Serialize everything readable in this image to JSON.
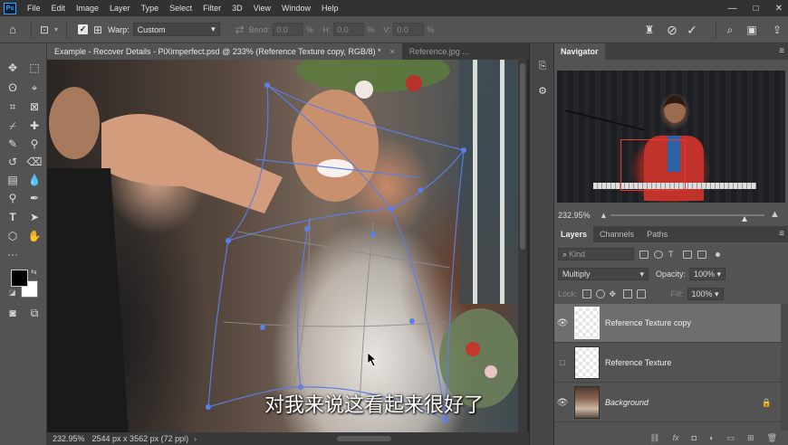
{
  "app": {
    "logo": "Ps"
  },
  "menu": [
    "File",
    "Edit",
    "Image",
    "Layer",
    "Type",
    "Select",
    "Filter",
    "3D",
    "View",
    "Window",
    "Help"
  ],
  "window_controls": {
    "minimize": "—",
    "maximize": "□",
    "close": "✕"
  },
  "options_bar": {
    "warp_label": "Warp:",
    "warp_value": "Custom",
    "bend_label": "Bend:",
    "bend_value": "0.0",
    "bend_unit": "%",
    "h_label": "H:",
    "h_value": "0.0",
    "h_unit": "%",
    "v_label": "V:",
    "v_value": "0.0",
    "v_unit": "%",
    "confirm_icon": "✓",
    "cancel_icon": "⊘"
  },
  "doc_tabs": [
    {
      "label": "Example - Recover Details - PiXimperfect.psd @ 233% (Reference Texture copy, RGB/8) *",
      "close": "×",
      "active": true
    },
    {
      "label": "Reference.jpg ...",
      "active": false
    }
  ],
  "canvas": {
    "subtitle": "对我来说这看起来很好了"
  },
  "status_bar": {
    "zoom": "232.95%",
    "doc_size": "2544 px x 3562 px (72 ppi)",
    "arrow": "›"
  },
  "navigator": {
    "title": "Navigator",
    "zoom": "232.95%",
    "slider_fraction": 0.87
  },
  "layers_panel": {
    "tabs": [
      "Layers",
      "Channels",
      "Paths"
    ],
    "filter_kind": "Kind",
    "blend_mode": "Multiply",
    "opacity_label": "Opacity:",
    "opacity_value": "100%",
    "lock_label": "Lock:",
    "fill_label": "Fill:",
    "fill_value": "100%",
    "layers": [
      {
        "name": "Reference Texture copy",
        "visible": true,
        "selected": true
      },
      {
        "name": "Reference Texture",
        "visible": false,
        "selected": false
      },
      {
        "name": "Background",
        "visible": true,
        "selected": false,
        "locked": true
      }
    ],
    "footer_icons": [
      "link-icon",
      "fx-icon",
      "mask-icon",
      "adjustment-icon",
      "group-icon",
      "new-layer-icon",
      "trash-icon"
    ],
    "footer_glyphs": {
      "link": "⛓",
      "fx": "fx",
      "mask": "◘",
      "adjustment": "◐",
      "group": "▭",
      "new_layer": "⊞",
      "trash": "🗑"
    }
  }
}
